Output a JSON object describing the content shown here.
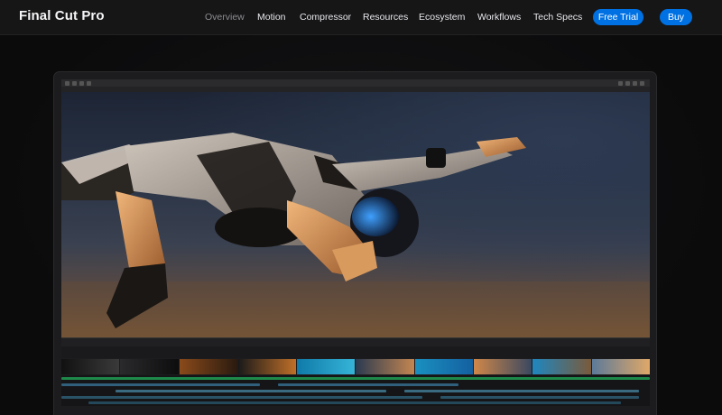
{
  "nav": {
    "brand": "Final Cut Pro",
    "links": [
      {
        "label": "Overview",
        "active": true
      },
      {
        "label": "Motion"
      },
      {
        "label": "Compressor"
      },
      {
        "label": "Resources"
      },
      {
        "label": "Ecosystem"
      },
      {
        "label": "Workflows"
      },
      {
        "label": "Tech Specs"
      }
    ],
    "free_trial": "Free Trial",
    "buy": "Buy"
  },
  "colors": {
    "accent": "#0071e3",
    "nav_bg": "#161617",
    "page_bg": "#0b0b0c"
  }
}
